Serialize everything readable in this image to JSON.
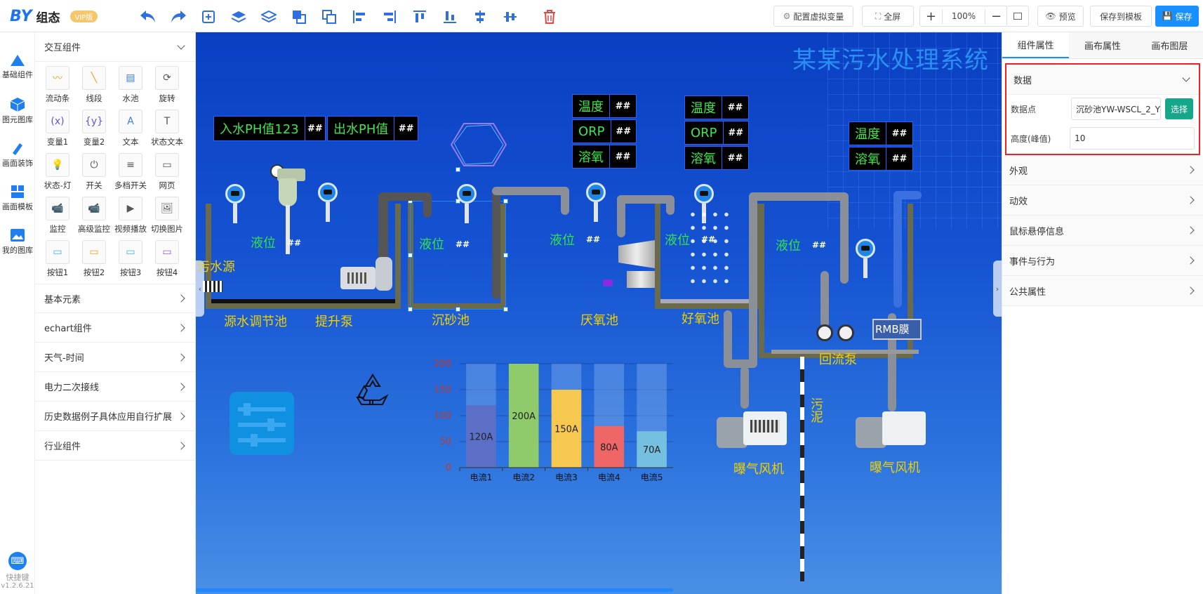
{
  "app": {
    "logo": "BY",
    "name": "组态",
    "badge": "VIP版"
  },
  "toolbar": {
    "configure_vars": "配置虚拟变量",
    "fullscreen": "全屏",
    "zoom": "100%",
    "preview": "预览",
    "save_template": "保存到模板",
    "save": "保存",
    "tools": [
      "undo-icon",
      "redo-icon",
      "add-layer-icon",
      "layer-up-icon",
      "layer-down-icon",
      "bring-front-icon",
      "send-back-icon",
      "align-left-icon",
      "align-right-icon",
      "align-top-icon",
      "align-bottom-icon",
      "align-hcenter-icon",
      "align-vcenter-icon",
      "delete-icon"
    ]
  },
  "rail": {
    "items": [
      "基础组件",
      "图元图库",
      "画面装饰",
      "画面模板",
      "我的图库"
    ],
    "shortcuts": "快捷键",
    "version": "v1.2.6.21"
  },
  "palette": {
    "interactive_title": "交互组件",
    "components": [
      "流动条",
      "线段",
      "水池",
      "旋转",
      "变量1",
      "变量2",
      "文本",
      "状态文本",
      "状态-灯",
      "开关",
      "多档开关",
      "网页",
      "监控",
      "高级监控",
      "视频播放",
      "切换图片",
      "按钮1",
      "按钮2",
      "按钮3",
      "按钮4"
    ],
    "sections": [
      "基本元素",
      "echart组件",
      "天气-时间",
      "电力二次接线",
      "历史数据例子具体应用自行扩展",
      "行业组件"
    ]
  },
  "canvas": {
    "title": "某某污水处理系统",
    "ph_in_label": "入水PH值123",
    "ph_out_label": "出水PH值",
    "hash": "##",
    "box_temp": "温度",
    "box_orp": "ORP",
    "box_do": "溶氧",
    "level": "液位",
    "source": "污水源",
    "tanks": [
      "源水调节池",
      "提升泵",
      "沉砂池",
      "厌氧池",
      "好氧池"
    ],
    "return_pump": "回流泵",
    "blower": "曝气风机",
    "sludge": "污泥",
    "rmb": "RMB膜"
  },
  "chart_data": {
    "type": "bar",
    "categories": [
      "电流1",
      "电流2",
      "电流3",
      "电流4",
      "电流5"
    ],
    "values": [
      120,
      200,
      150,
      80,
      70
    ],
    "data_labels": [
      "120A",
      "200A",
      "150A",
      "80A",
      "70A"
    ],
    "ylim": [
      0,
      200
    ],
    "yticks": [
      "0",
      "50",
      "100",
      "150",
      "200"
    ],
    "colors": [
      "#5b6fc7",
      "#8fcb6a",
      "#f6c850",
      "#ee6666",
      "#74c0de"
    ],
    "grid": true,
    "legend": "none"
  },
  "panel": {
    "tabs": [
      "组件属性",
      "画布属性",
      "画布图层"
    ],
    "data_section": "数据",
    "datapoint_label": "数据点",
    "datapoint_value": "沉砂池YW-WSCL_2_Y",
    "choose": "选择",
    "height_label": "高度(峰值)",
    "height_value": "10",
    "sections": [
      "外观",
      "动效",
      "鼠标悬停信息",
      "事件与行为",
      "公共属性"
    ]
  }
}
